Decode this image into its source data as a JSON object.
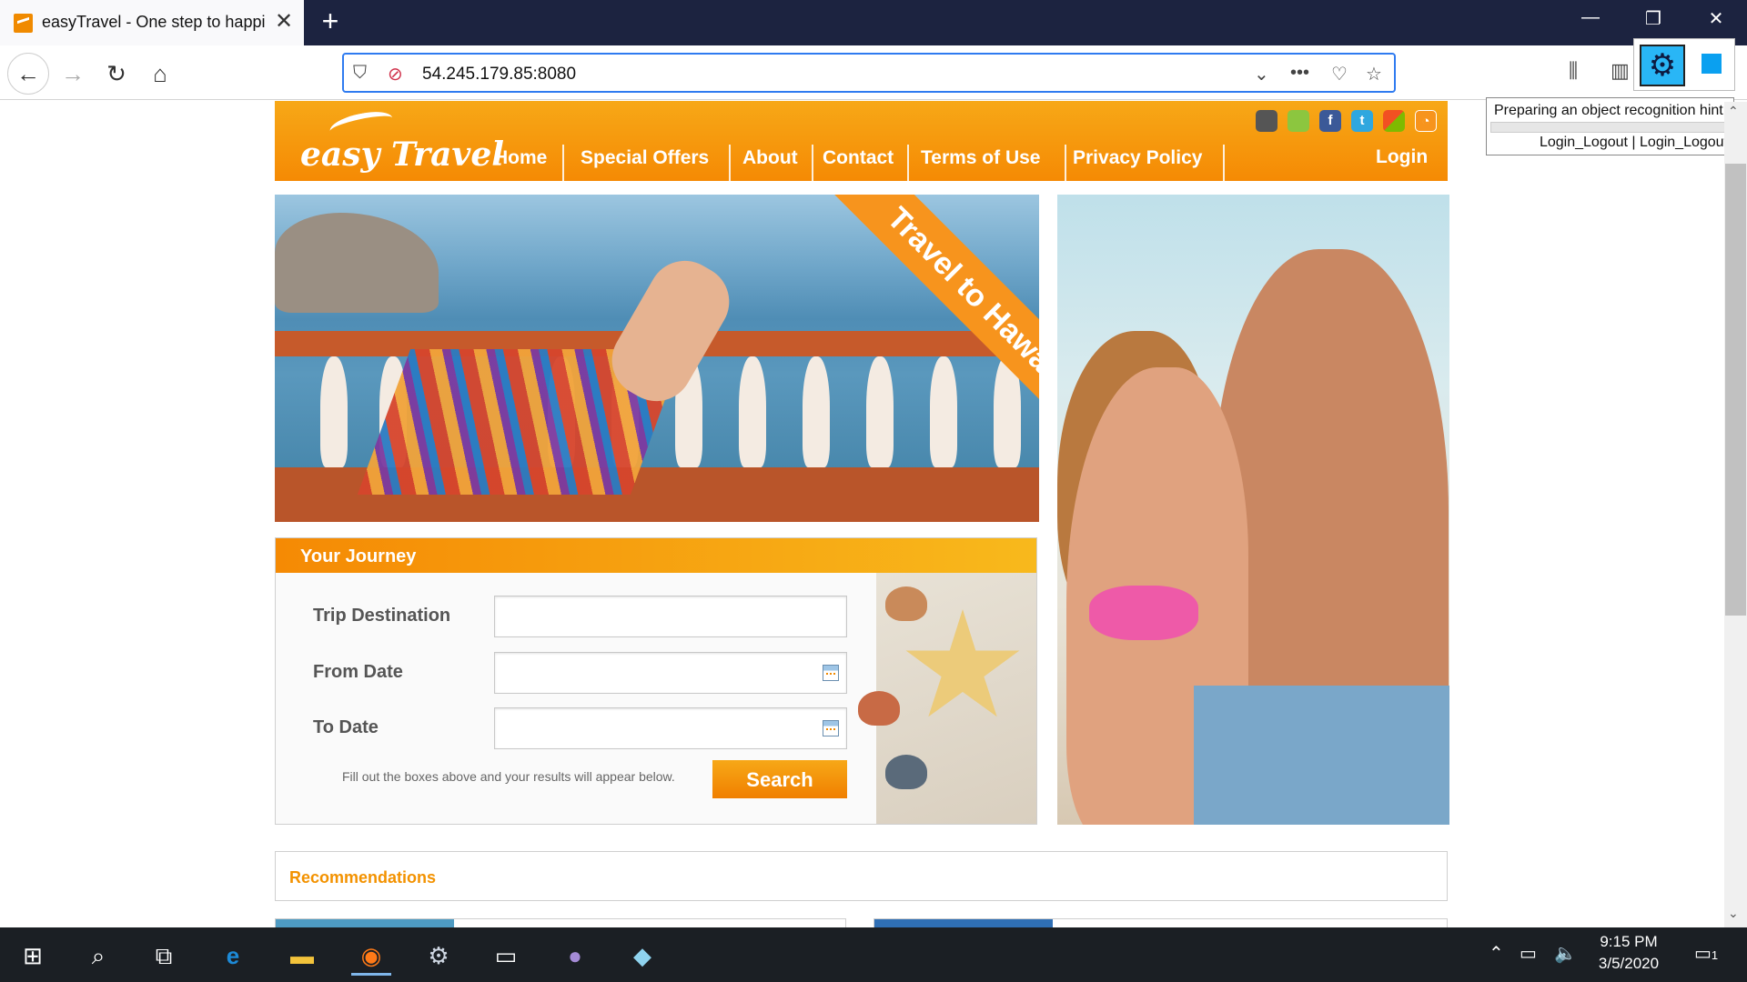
{
  "browser": {
    "tab_title": "easyTravel - One step to happiness",
    "new_tab_label": "+",
    "url": "54.245.179.85:8080",
    "window_controls": {
      "minimize": "—",
      "restore": "❐",
      "close": "✕"
    }
  },
  "recognition_hint": {
    "title": "Preparing an object recognition hint.",
    "text": "Login_Logout | Login_Logout"
  },
  "site": {
    "logo": "easy Travel",
    "nav": [
      "Home",
      "Special Offers",
      "About",
      "Contact",
      "Terms of Use",
      "Privacy Policy"
    ],
    "login": "Login",
    "social_icons": [
      "apple-icon",
      "android-icon",
      "facebook-icon",
      "twitter-icon",
      "windows-icon",
      "rss-icon"
    ],
    "hero_ribbon": "Travel to Hawaii"
  },
  "journey": {
    "title": "Your Journey",
    "fields": [
      {
        "label": "Trip Destination",
        "value": "",
        "has_calendar": false
      },
      {
        "label": "From Date",
        "value": "",
        "has_calendar": true
      },
      {
        "label": "To Date",
        "value": "",
        "has_calendar": true
      }
    ],
    "helper": "Fill out the boxes above and your results will appear below.",
    "search_label": "Search"
  },
  "recommendations": {
    "title": "Recommendations"
  },
  "taskbar": {
    "time": "9:15 PM",
    "date": "3/5/2020",
    "notifications": "1",
    "apps": [
      "start-icon",
      "search-icon",
      "task-view-icon",
      "edge-icon",
      "file-explorer-icon",
      "firefox-icon",
      "settings-icon",
      "terminal-icon",
      "github-icon",
      "app-icon"
    ]
  },
  "colors": {
    "brand_orange": "#f7941d",
    "brand_gold": "#f8b91c",
    "chrome_dark": "#1c2340",
    "url_focus": "#2f7bf0"
  }
}
